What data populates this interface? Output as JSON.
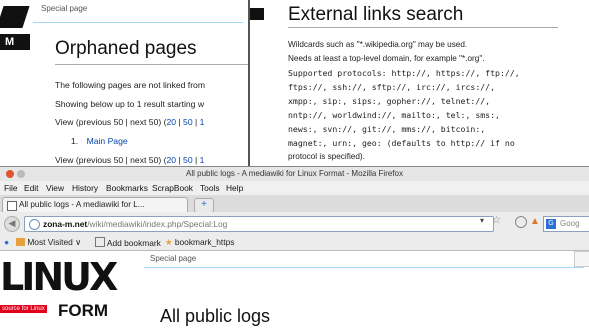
{
  "back_window": {
    "tab_label": "Special page",
    "title": "Orphaned pages",
    "intro": "The following pages are not linked from",
    "showing": "Showing below up to 1 result starting w",
    "nav_prefix": "View (previous 50 | next 50) (",
    "nav_20": "20",
    "nav_sep1": " | ",
    "nav_50": "50",
    "nav_sep2": " | ",
    "nav_100": "1",
    "result_number": "1.",
    "result_link": "Main Page"
  },
  "external_links_window": {
    "title": "External links search",
    "lines": [
      "Wildcards such as \"*.wikipedia.org\" may be used.",
      "Needs at least a top-level domain, for example \"*.org\".",
      "Supported protocols: http://, https://, ftp://,",
      "ftps://, ssh://, sftp://, irc://, ircs://,",
      "xmpp:, sip:, sips:, gopher://, telnet://,",
      "nntp://, worldwind://, mailto:, tel:, sms:,",
      "news:, svn://, git://, mms://, bitcoin:,",
      "magnet:, urn:, geo: (defaults to http:// if no",
      "protocol is specified)."
    ]
  },
  "firefox": {
    "window_title": "All public logs - A mediawiki for Linux Format - Mozilla Firefox",
    "menu": [
      "File",
      "Edit",
      "View",
      "History",
      "Bookmarks",
      "ScrapBook",
      "Tools",
      "Help"
    ],
    "tab_label": "All public logs - A mediawiki for L...",
    "new_tab": "+",
    "url_domain": "zona-m.net",
    "url_path": "/wiki/mediawiki/index.php/Special:Log",
    "search_placeholder": "Goog",
    "bookmarks": [
      "Most Visited",
      "Add bookmark",
      "bookmark_https"
    ],
    "page_tab": "Special page",
    "page_title": "All public logs",
    "logo_source": "source for Linux",
    "logo_word": "FORM"
  },
  "colors": {
    "link": "#0645ad",
    "tab_border": "#a7d7f9",
    "logo_red": "#e2001a"
  }
}
